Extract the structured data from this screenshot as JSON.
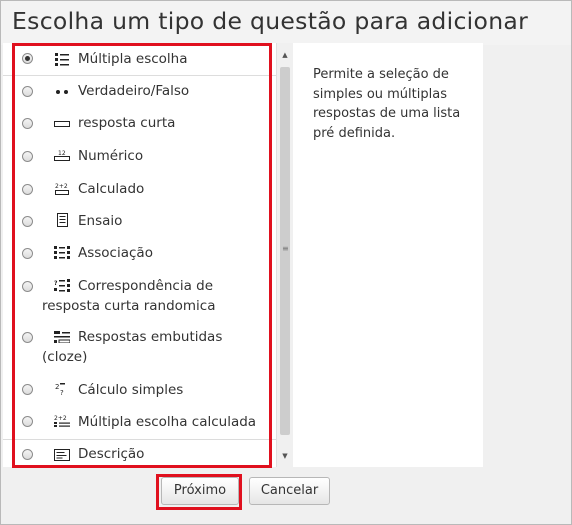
{
  "dialog": {
    "title": "Escolha um tipo de questão para adicionar"
  },
  "question_types": [
    {
      "label": "Múltipla escolha",
      "icon": "multichoice-icon",
      "selected": true
    },
    {
      "label": "Verdadeiro/Falso",
      "icon": "truefalse-icon",
      "selected": false
    },
    {
      "label": "resposta curta",
      "icon": "shortanswer-icon",
      "selected": false
    },
    {
      "label": "Numérico",
      "icon": "numerical-icon",
      "selected": false
    },
    {
      "label": "Calculado",
      "icon": "calculated-icon",
      "selected": false
    },
    {
      "label": "Ensaio",
      "icon": "essay-icon",
      "selected": false
    },
    {
      "label": "Associação",
      "icon": "matching-icon",
      "selected": false
    },
    {
      "label": "Correspondência de",
      "label2": "resposta curta randomica",
      "icon": "randomsamatch-icon",
      "selected": false
    },
    {
      "label": "Respostas embutidas",
      "label2": "(cloze)",
      "icon": "multianswer-icon",
      "selected": false
    },
    {
      "label": "Cálculo simples",
      "icon": "calculatedsimple-icon",
      "selected": false
    },
    {
      "label": "Múltipla escolha calculada",
      "icon": "calculatedmulti-icon",
      "selected": false
    },
    {
      "label": "Descrição",
      "icon": "description-icon",
      "selected": false
    }
  ],
  "description": "Permite a seleção de simples ou múltiplas respostas de uma lista pré definida.",
  "buttons": {
    "next": "Próximo",
    "cancel": "Cancelar"
  },
  "colors": {
    "highlight": "#e0101e"
  }
}
